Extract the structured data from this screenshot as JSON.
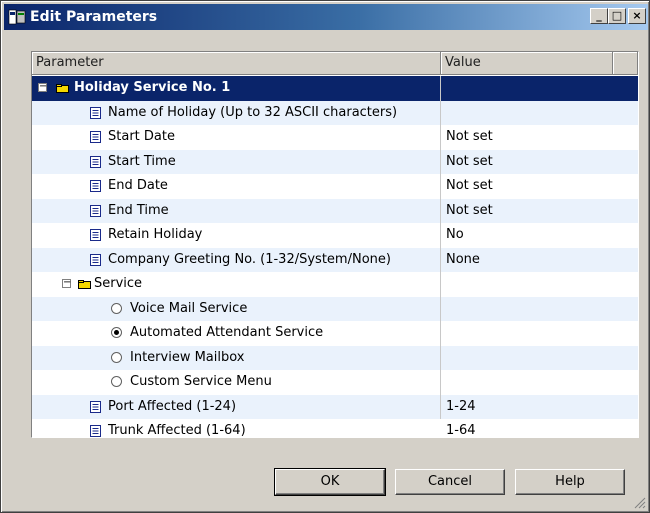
{
  "window": {
    "title": "Edit Parameters",
    "controls": {
      "minimize": "_",
      "maximize": "□",
      "close": "×"
    }
  },
  "columns": {
    "parameter": "Parameter",
    "value": "Value"
  },
  "rows": [
    {
      "label": "Holiday Service No. 1",
      "value": "",
      "kind": "folder",
      "expander": "−",
      "selected": true
    },
    {
      "label": "Name of Holiday (Up to 32 ASCII characters)",
      "value": "",
      "kind": "doc"
    },
    {
      "label": "Start Date",
      "value": "Not set",
      "kind": "doc"
    },
    {
      "label": "Start Time",
      "value": "Not set",
      "kind": "doc"
    },
    {
      "label": "End Date",
      "value": "Not set",
      "kind": "doc"
    },
    {
      "label": "End Time",
      "value": "Not set",
      "kind": "doc"
    },
    {
      "label": "Retain Holiday",
      "value": "No",
      "kind": "doc"
    },
    {
      "label": "Company Greeting No. (1-32/System/None)",
      "value": "None",
      "kind": "doc"
    },
    {
      "label": "Service",
      "value": "",
      "kind": "folder",
      "expander": "−"
    },
    {
      "label": "Voice Mail Service",
      "value": "",
      "kind": "radio",
      "checked": false
    },
    {
      "label": "Automated Attendant Service",
      "value": "",
      "kind": "radio",
      "checked": true
    },
    {
      "label": "Interview Mailbox",
      "value": "",
      "kind": "radio",
      "checked": false
    },
    {
      "label": "Custom Service Menu",
      "value": "",
      "kind": "radio",
      "checked": false
    },
    {
      "label": "Port Affected (1-24)",
      "value": "1-24",
      "kind": "doc"
    },
    {
      "label": "Trunk Affected (1-64)",
      "value": "1-64",
      "kind": "doc"
    }
  ],
  "buttons": {
    "ok": "OK",
    "cancel": "Cancel",
    "help": "Help"
  },
  "colors": {
    "selection": "#0a246a",
    "alt_row": "#eaf2fc",
    "folder": "#f5d800",
    "doc_icon": "#1a2a8a"
  }
}
